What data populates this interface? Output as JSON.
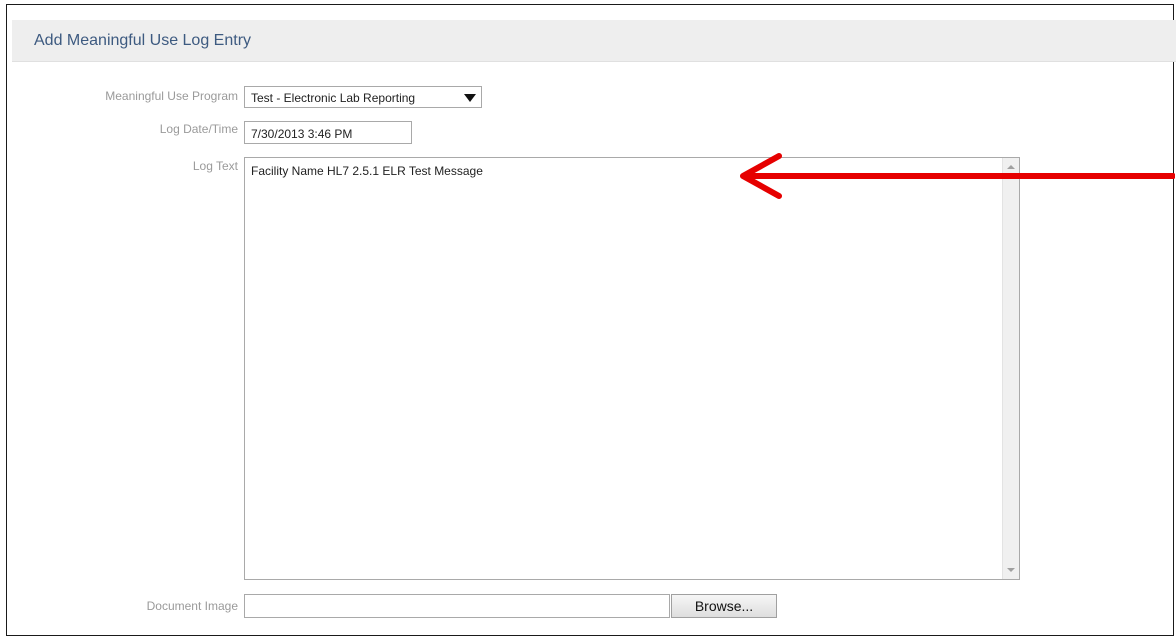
{
  "header": {
    "title": "Add Meaningful Use Log Entry"
  },
  "form": {
    "program": {
      "label": "Meaningful Use Program",
      "value": "Test - Electronic Lab Reporting"
    },
    "log_datetime": {
      "label": "Log Date/Time",
      "value": "7/30/2013 3:46 PM"
    },
    "log_text": {
      "label": "Log Text",
      "value": "Facility Name HL7 2.5.1 ELR Test Message"
    },
    "document_image": {
      "label": "Document Image",
      "value": "",
      "browse_label": "Browse..."
    }
  },
  "annotation": {
    "color": "#e60000"
  }
}
